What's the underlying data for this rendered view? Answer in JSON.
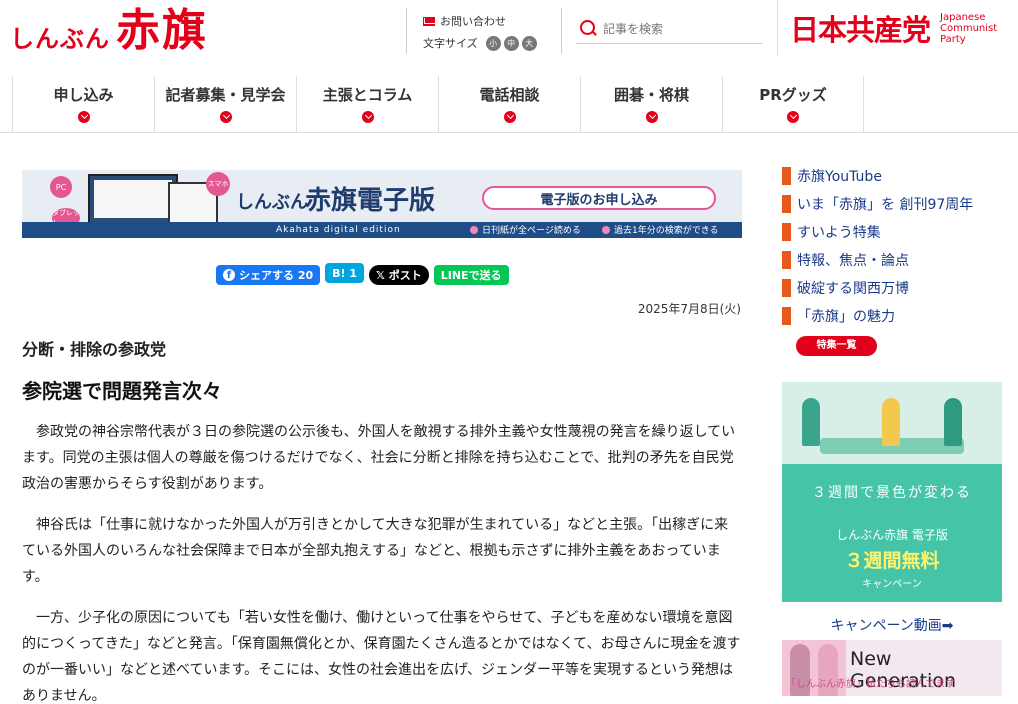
{
  "header": {
    "logo_small": "しんぶん",
    "logo_big": "赤旗",
    "contact": "お問い合わせ",
    "font_size_label": "文字サイズ",
    "font_sizes": [
      "小",
      "中",
      "大"
    ],
    "search_placeholder": "記事を検索",
    "party_jp": "日本共産党",
    "party_en_1": "Japanese",
    "party_en_2": "Communist",
    "party_en_3": "Party"
  },
  "nav": [
    {
      "label": "申し込み"
    },
    {
      "label": "記者募集・見学会"
    },
    {
      "label": "主張とコラム"
    },
    {
      "label": "電話相談"
    },
    {
      "label": "囲碁・将棋"
    },
    {
      "label": "PRグッズ"
    }
  ],
  "banner": {
    "badge_pc": "PC",
    "badge_tablet": "タブレット",
    "badge_smartphone": "スマホ",
    "title_small": "しんぶん",
    "title_big": "赤旗電子版",
    "subtitle": "Akahata digital edition",
    "apply": "電子版のお申し込み",
    "feature1": "日刊紙が全ページ読める",
    "feature2": "過去1年分の検索ができる"
  },
  "social": {
    "facebook": "シェアする 20",
    "hatena": "B! 1",
    "x": "𝕏 ポスト",
    "line": "LINEで送る"
  },
  "article": {
    "date": "2025年7月8日(火)",
    "kicker": "分断・排除の参政党",
    "headline": "参院選で問題発言次々",
    "paragraphs": [
      "参政党の神谷宗幣代表が３日の参院選の公示後も、外国人を敵視する排外主義や女性蔑視の発言を繰り返しています。同党の主張は個人の尊厳を傷つけるだけでなく、社会に分断と排除を持ち込むことで、批判の矛先を自民党政治の害悪からそらす役割があります。",
      "神谷氏は「仕事に就けなかった外国人が万引きとかして大きな犯罪が生まれている」などと主張。「出稼ぎに来ている外国人のいろんな社会保障まで日本が全部丸抱えする」などと、根拠も示さずに排外主義をあおっています。",
      "一方、少子化の原因についても「若い女性を働け、働けといって仕事をやらせて、子どもを産めない環境を意図的につくってきた」などと発言。「保育園無償化とか、保育園たくさん造るとかではなくて、お母さんに現金を渡すのが一番いい」などと述べています。そこには、女性の社会進出を広げ、ジェンダー平等を実現するという発想はありません。"
    ]
  },
  "sidebar": {
    "items": [
      {
        "label": "赤旗YouTube"
      },
      {
        "label": "いま「赤旗」を 創刊97周年"
      },
      {
        "label": "すいよう特集"
      },
      {
        "label": "特報、焦点・論点"
      },
      {
        "label": "破綻する関西万博"
      },
      {
        "label": "「赤旗」の魅力"
      }
    ],
    "more": "特集一覧",
    "ad": {
      "line1": "３週間で景色が変わる",
      "line2": "しんぶん赤旗 電子版",
      "line3": "３週間無料",
      "line4": "キャンペーン"
    },
    "campaign_link": "キャンペーン動画➡",
    "ng_title": "New Generation",
    "ng_sub": "「しんぶん赤旗」私たちも読んでます"
  }
}
